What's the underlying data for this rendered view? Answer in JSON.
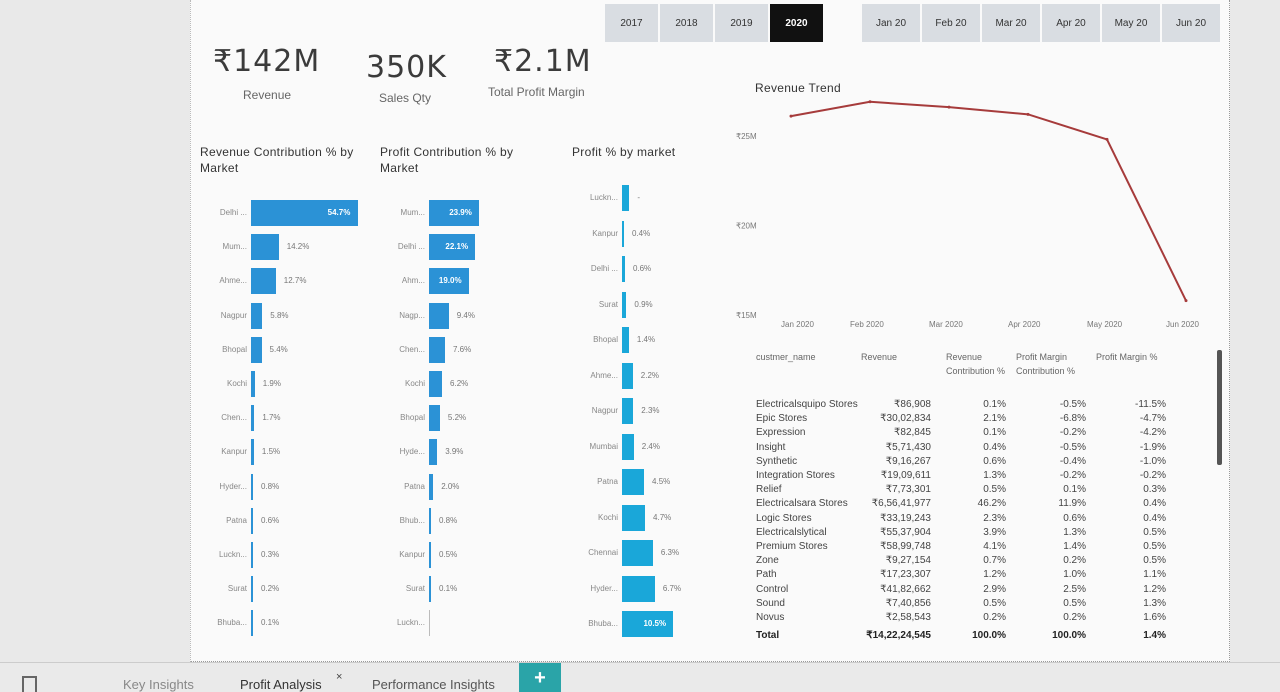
{
  "year_slicer": [
    {
      "label": "2017",
      "selected": false
    },
    {
      "label": "2018",
      "selected": false
    },
    {
      "label": "2019",
      "selected": false
    },
    {
      "label": "2020",
      "selected": true
    }
  ],
  "month_slicer": [
    {
      "label": "Jan 20"
    },
    {
      "label": "Feb 20"
    },
    {
      "label": "Mar 20"
    },
    {
      "label": "Apr 20"
    },
    {
      "label": "May 20"
    },
    {
      "label": "Jun 20"
    }
  ],
  "kpis": {
    "revenue": {
      "value": "₹142M",
      "label": "Revenue"
    },
    "sales_qty": {
      "value": "350K",
      "label": "Sales Qty"
    },
    "profit_margin": {
      "value": "₹2.1M",
      "label": "Total Profit Margin"
    }
  },
  "revenue_contribution": {
    "title": "Revenue Contribution % by Market",
    "rows": [
      {
        "market": "Delhi ...",
        "value": 54.7,
        "label": "54.7%"
      },
      {
        "market": "Mum...",
        "value": 14.2,
        "label": "14.2%"
      },
      {
        "market": "Ahme...",
        "value": 12.7,
        "label": "12.7%"
      },
      {
        "market": "Nagpur",
        "value": 5.8,
        "label": "5.8%"
      },
      {
        "market": "Bhopal",
        "value": 5.4,
        "label": "5.4%"
      },
      {
        "market": "Kochi",
        "value": 1.9,
        "label": "1.9%"
      },
      {
        "market": "Chen...",
        "value": 1.7,
        "label": "1.7%"
      },
      {
        "market": "Kanpur",
        "value": 1.5,
        "label": "1.5%"
      },
      {
        "market": "Hyder...",
        "value": 0.8,
        "label": "0.8%"
      },
      {
        "market": "Patna",
        "value": 0.6,
        "label": "0.6%"
      },
      {
        "market": "Luckn...",
        "value": 0.3,
        "label": "0.3%"
      },
      {
        "market": "Surat",
        "value": 0.2,
        "label": "0.2%"
      },
      {
        "market": "Bhuba...",
        "value": 0.1,
        "label": "0.1%"
      }
    ]
  },
  "profit_contribution": {
    "title": "Profit Contribution % by Market",
    "rows": [
      {
        "market": "Mum...",
        "value": 23.9,
        "label": "23.9%"
      },
      {
        "market": "Delhi ...",
        "value": 22.1,
        "label": "22.1%"
      },
      {
        "market": "Ahm...",
        "value": 19.0,
        "label": "19.0%"
      },
      {
        "market": "Nagp...",
        "value": 9.4,
        "label": "9.4%"
      },
      {
        "market": "Chen...",
        "value": 7.6,
        "label": "7.6%"
      },
      {
        "market": "Kochi",
        "value": 6.2,
        "label": "6.2%"
      },
      {
        "market": "Bhopal",
        "value": 5.2,
        "label": "5.2%"
      },
      {
        "market": "Hyde...",
        "value": 3.9,
        "label": "3.9%"
      },
      {
        "market": "Patna",
        "value": 2.0,
        "label": "2.0%"
      },
      {
        "market": "Bhub...",
        "value": 0.8,
        "label": "0.8%"
      },
      {
        "market": "Kanpur",
        "value": 0.5,
        "label": "0.5%"
      },
      {
        "market": "Surat",
        "value": 0.1,
        "label": "0.1%"
      },
      {
        "market": "Luckn...",
        "value": 0.0,
        "label": ""
      }
    ]
  },
  "profit_pct_by_market": {
    "title": "Profit % by market",
    "rows": [
      {
        "market": "Luckn...",
        "value": 1.5,
        "label": "-"
      },
      {
        "market": "Kanpur",
        "value": 0.4,
        "label": "0.4%"
      },
      {
        "market": "Delhi ...",
        "value": 0.6,
        "label": "0.6%"
      },
      {
        "market": "Surat",
        "value": 0.9,
        "label": "0.9%"
      },
      {
        "market": "Bhopal",
        "value": 1.4,
        "label": "1.4%"
      },
      {
        "market": "Ahme...",
        "value": 2.2,
        "label": "2.2%"
      },
      {
        "market": "Nagpur",
        "value": 2.3,
        "label": "2.3%"
      },
      {
        "market": "Mumbai",
        "value": 2.4,
        "label": "2.4%"
      },
      {
        "market": "Patna",
        "value": 4.5,
        "label": "4.5%"
      },
      {
        "market": "Kochi",
        "value": 4.7,
        "label": "4.7%"
      },
      {
        "market": "Chennai",
        "value": 6.3,
        "label": "6.3%"
      },
      {
        "market": "Hyder...",
        "value": 6.7,
        "label": "6.7%"
      },
      {
        "market": "Bhuba...",
        "value": 10.5,
        "label": "10.5%"
      }
    ]
  },
  "chart_data": {
    "type": "line",
    "title": "Revenue Trend",
    "x": [
      "Jan 2020",
      "Feb 2020",
      "Mar 2020",
      "Apr 2020",
      "May 2020",
      "Jun 2020"
    ],
    "values": [
      26.1,
      26.9,
      26.6,
      26.2,
      24.8,
      15.8
    ],
    "y_ticks": [
      "₹25M",
      "₹20M",
      "₹15M"
    ],
    "ylim": [
      15,
      27
    ],
    "series_color": "#a63b3b"
  },
  "table": {
    "headers": [
      "custmer_name",
      "Revenue",
      "Revenue Contribution %",
      "Profit Margin Contribution %",
      "Profit Margin %"
    ],
    "rows": [
      [
        "Electricalsquipo Stores",
        "₹86,908",
        "0.1%",
        "-0.5%",
        "-11.5%"
      ],
      [
        "Epic Stores",
        "₹30,02,834",
        "2.1%",
        "-6.8%",
        "-4.7%"
      ],
      [
        "Expression",
        "₹82,845",
        "0.1%",
        "-0.2%",
        "-4.2%"
      ],
      [
        "Insight",
        "₹5,71,430",
        "0.4%",
        "-0.5%",
        "-1.9%"
      ],
      [
        "Synthetic",
        "₹9,16,267",
        "0.6%",
        "-0.4%",
        "-1.0%"
      ],
      [
        "Integration Stores",
        "₹19,09,611",
        "1.3%",
        "-0.2%",
        "-0.2%"
      ],
      [
        "Relief",
        "₹7,73,301",
        "0.5%",
        "0.1%",
        "0.3%"
      ],
      [
        "Electricalsara Stores",
        "₹6,56,41,977",
        "46.2%",
        "11.9%",
        "0.4%"
      ],
      [
        "Logic Stores",
        "₹33,19,243",
        "2.3%",
        "0.6%",
        "0.4%"
      ],
      [
        "Electricalslytical",
        "₹55,37,904",
        "3.9%",
        "1.3%",
        "0.5%"
      ],
      [
        "Premium Stores",
        "₹58,99,748",
        "4.1%",
        "1.4%",
        "0.5%"
      ],
      [
        "Zone",
        "₹9,27,154",
        "0.7%",
        "0.2%",
        "0.5%"
      ],
      [
        "Path",
        "₹17,23,307",
        "1.2%",
        "1.0%",
        "1.1%"
      ],
      [
        "Control",
        "₹41,82,662",
        "2.9%",
        "2.5%",
        "1.2%"
      ],
      [
        "Sound",
        "₹7,40,856",
        "0.5%",
        "0.5%",
        "1.3%"
      ],
      [
        "Novus",
        "₹2,58,543",
        "0.2%",
        "0.2%",
        "1.6%"
      ]
    ],
    "total": [
      "Total",
      "₹14,22,24,545",
      "100.0%",
      "100.0%",
      "1.4%"
    ]
  },
  "tabs": {
    "key_insights": "Key Insights",
    "profit_analysis": "Profit Analysis",
    "performance_insights": "Performance Insights",
    "close_glyph": "×",
    "add_glyph": "+"
  },
  "colors": {
    "bar": "#2b92d6",
    "bar_light": "#1aa7d9",
    "line": "#a63b3b"
  }
}
